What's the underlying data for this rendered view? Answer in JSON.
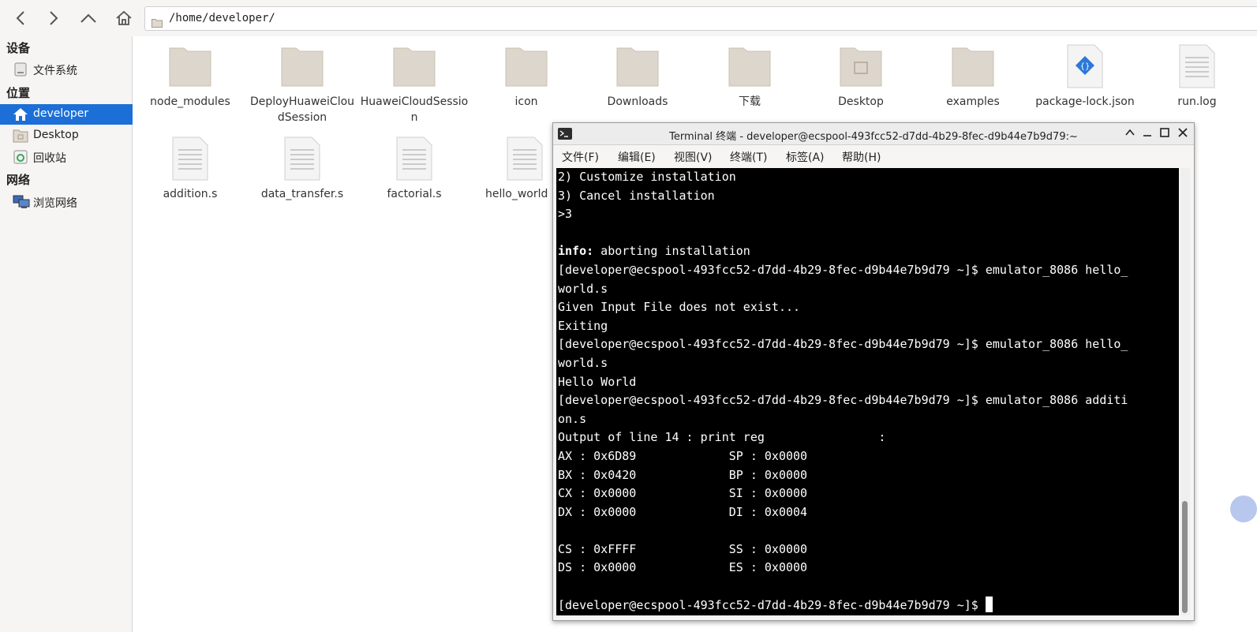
{
  "toolbar": {
    "path": "/home/developer/",
    "icons": [
      "back-icon",
      "forward-icon",
      "up-icon",
      "home-icon"
    ]
  },
  "sidebar": {
    "devices_header": "设备",
    "places_header": "位置",
    "network_header": "网络",
    "items": [
      {
        "label": "文件系统",
        "icon": "drive-icon"
      },
      {
        "label": "developer",
        "icon": "home-icon"
      },
      {
        "label": "Desktop",
        "icon": "desktop-icon"
      },
      {
        "label": "回收站",
        "icon": "trash-icon"
      },
      {
        "label": "浏览网络",
        "icon": "network-icon"
      }
    ]
  },
  "files": [
    {
      "name": "node_modules",
      "type": "folder"
    },
    {
      "name": "DeployHuaweiCloudSession",
      "type": "folder"
    },
    {
      "name": "HuaweiCloudSession",
      "type": "folder"
    },
    {
      "name": "icon",
      "type": "folder"
    },
    {
      "name": "Downloads",
      "type": "folder"
    },
    {
      "name": "下载",
      "type": "folder"
    },
    {
      "name": "Desktop",
      "type": "folder"
    },
    {
      "name": "examples",
      "type": "folder"
    },
    {
      "name": "package-lock.json",
      "type": "json"
    },
    {
      "name": "run.log",
      "type": "text"
    },
    {
      "name": "addition.s",
      "type": "text"
    },
    {
      "name": "data_transfer.s",
      "type": "text"
    },
    {
      "name": "factorial.s",
      "type": "text"
    },
    {
      "name": "hello_world",
      "type": "text"
    }
  ],
  "terminal": {
    "title": "Terminal 终端 - developer@ecspool-493fcc52-d7dd-4b29-8fec-d9b44e7b9d79:~",
    "menu": [
      "文件(F)",
      "编辑(E)",
      "视图(V)",
      "终端(T)",
      "标签(A)",
      "帮助(H)"
    ],
    "lines": [
      "2) Customize installation",
      "3) Cancel installation",
      ">3",
      "",
      "info: aborting installation",
      "[developer@ecspool-493fcc52-d7dd-4b29-8fec-d9b44e7b9d79 ~]$ emulator_8086 hello_",
      "world.s",
      "Given Input File does not exist...",
      "Exiting",
      "[developer@ecspool-493fcc52-d7dd-4b29-8fec-d9b44e7b9d79 ~]$ emulator_8086 hello_",
      "world.s",
      "Hello World",
      "[developer@ecspool-493fcc52-d7dd-4b29-8fec-d9b44e7b9d79 ~]$ emulator_8086 additi",
      "on.s",
      "Output of line 14 : print reg                :",
      "AX : 0x6D89             SP : 0x0000",
      "BX : 0x0420             BP : 0x0000",
      "CX : 0x0000             SI : 0x0000",
      "DX : 0x0000             DI : 0x0004",
      "",
      "CS : 0xFFFF             SS : 0x0000",
      "DS : 0x0000             ES : 0x0000",
      "",
      "[developer@ecspool-493fcc52-d7dd-4b29-8fec-d9b44e7b9d79 ~]$ "
    ],
    "info_label": "info:"
  }
}
